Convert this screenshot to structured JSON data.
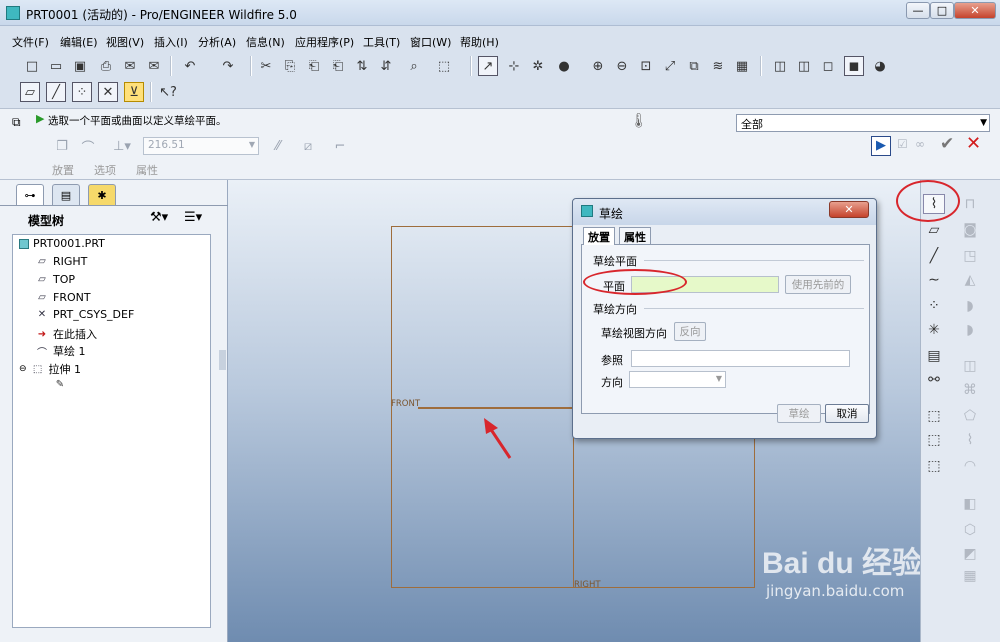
{
  "window": {
    "title": "PRT0001 (活动的) - Pro/ENGINEER Wildfire 5.0",
    "buttons": [
      "—",
      "□",
      "✕"
    ]
  },
  "menubar": {
    "items": [
      "文件(F)",
      "编辑(E)",
      "视图(V)",
      "插入(I)",
      "分析(A)",
      "信息(N)",
      "应用程序(P)",
      "工具(T)",
      "窗口(W)",
      "帮助(H)"
    ]
  },
  "dashboard": {
    "message": "选取一个平面或曲面以定义草绘平面。",
    "filter_value": "全部",
    "depth_value": "216.51",
    "tabs": [
      "放置",
      "选项",
      "属性"
    ]
  },
  "model_tree": {
    "title": "模型树",
    "items": [
      "PRT0001.PRT",
      "RIGHT",
      "TOP",
      "FRONT",
      "PRT_CSYS_DEF",
      "在此插入",
      "草绘 1",
      "拉伸 1"
    ]
  },
  "viewport": {
    "plane_labels": [
      "FRONT",
      "RIGHT"
    ]
  },
  "sketch_dialog": {
    "title": "草绘",
    "tabs": [
      "放置",
      "属性"
    ],
    "plane_group": "草绘平面",
    "plane_label": "平面",
    "use_previous": "使用先前的",
    "direction_group": "草绘方向",
    "view_direction": "草绘视图方向",
    "flip": "反向",
    "reference": "参照",
    "orientation": "方向",
    "sketch_button": "草绘",
    "cancel_button": "取消"
  },
  "watermark": {
    "brand": "Bai du 经验",
    "url": "jingyan.baidu.com"
  },
  "colors": {
    "plane_edge": "#9e6d3c",
    "highlight": "#d8262c",
    "plane_field": "#e6f9c9"
  }
}
